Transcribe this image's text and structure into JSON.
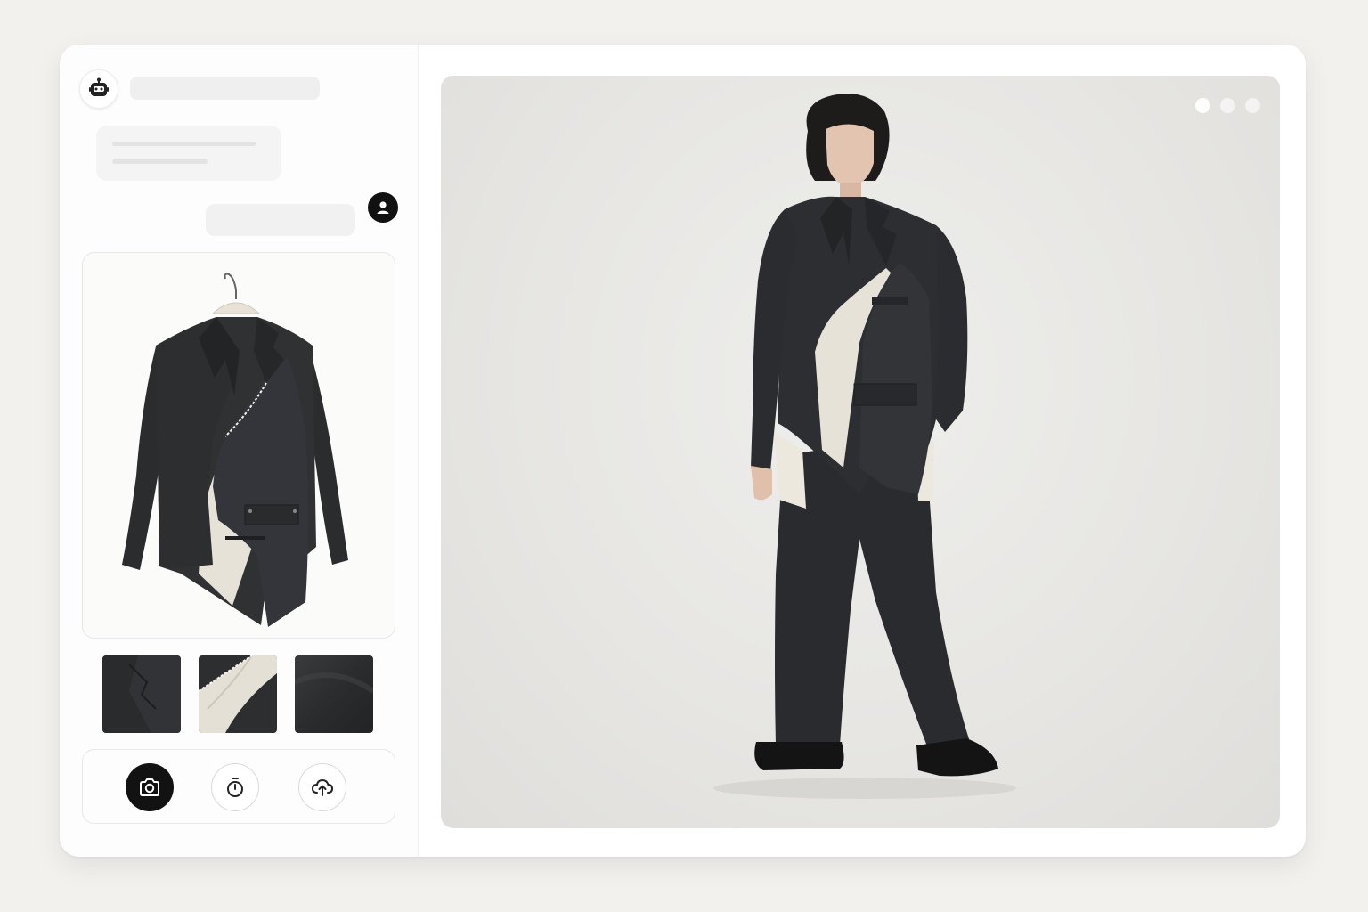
{
  "chat": {
    "bot_avatar_icon": "robot-icon",
    "user_avatar_icon": "user-icon"
  },
  "product": {
    "main_image": "jacket-on-hanger",
    "thumbnails": [
      "collar-detail",
      "raw-edge-lining-detail",
      "fabric-texture-detail"
    ]
  },
  "toolbar": {
    "buttons": [
      {
        "icon": "camera-icon",
        "active": true
      },
      {
        "icon": "timer-icon",
        "active": false
      },
      {
        "icon": "cloud-upload-icon",
        "active": false
      }
    ]
  },
  "preview": {
    "image": "model-wearing-outfit",
    "menu_icon": "more-dots-icon"
  },
  "colors": {
    "background": "#f3f1ee",
    "accent": "#121212",
    "garment": "#2b2c2e",
    "lining": "#e6e2d8"
  }
}
